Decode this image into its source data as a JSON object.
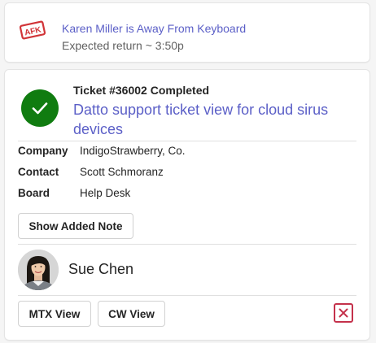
{
  "afk": {
    "stamp_text": "AFK",
    "title": "Karen Miller is Away From Keyboard",
    "subtitle": "Expected return ~ 3:50p",
    "icon": "afk-stamp-icon"
  },
  "ticket": {
    "status": "Ticket #36002 Completed",
    "title": "Datto support ticket view for cloud sirus devices",
    "status_icon": "checkmark-icon",
    "facts": [
      {
        "key": "Company",
        "value": "IndigoStrawberry, Co."
      },
      {
        "key": "Contact",
        "value": "Scott Schmoranz"
      },
      {
        "key": "Board",
        "value": "Help Desk"
      }
    ],
    "show_note_label": "Show Added Note",
    "person_name": "Sue Chen",
    "actions": {
      "mtx_view_label": "MTX View",
      "cw_view_label": "CW View",
      "close_icon": "close-icon"
    }
  },
  "colors": {
    "accent": "#5b5fc7",
    "success": "#107c10",
    "danger": "#c4314b",
    "stamp_red": "#d13438"
  }
}
